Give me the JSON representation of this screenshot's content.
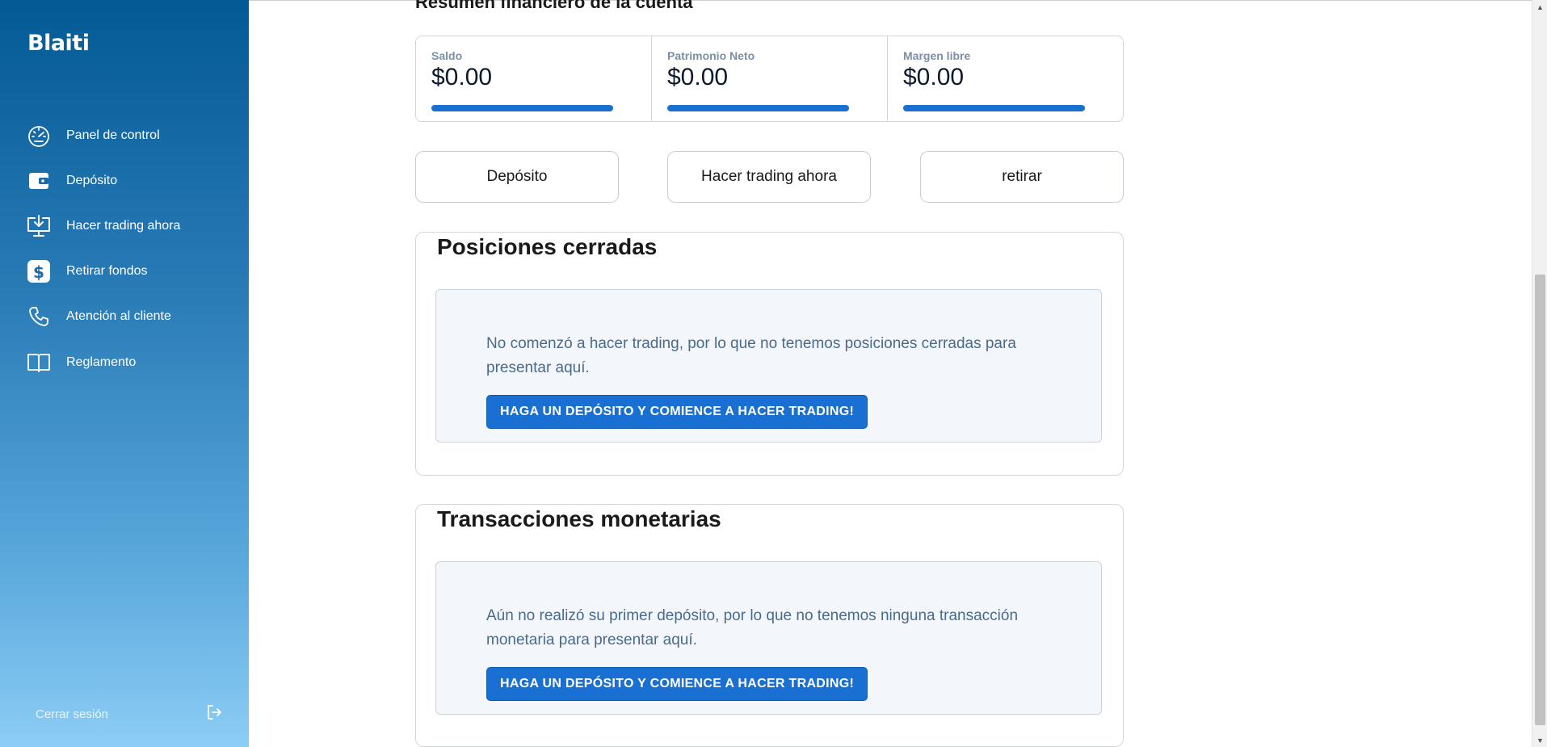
{
  "sidebar": {
    "brand": "Blaiti",
    "items": [
      {
        "label": "Panel de control",
        "icon": "gauge-icon"
      },
      {
        "label": "Depósito",
        "icon": "wallet-icon"
      },
      {
        "label": "Hacer trading ahora",
        "icon": "monitor-download-icon"
      },
      {
        "label": "Retirar fondos",
        "icon": "dollar-icon"
      },
      {
        "label": "Atención al cliente",
        "icon": "phone-icon"
      },
      {
        "label": "Reglamento",
        "icon": "book-icon"
      }
    ],
    "logout_label": "Cerrar sesión",
    "logout_icon": "logout-icon"
  },
  "main": {
    "section_heading": "Resumen financiero de la cuenta",
    "summary": [
      {
        "label": "Saldo",
        "value": "$0.00"
      },
      {
        "label": "Patrimonio Neto",
        "value": "$0.00"
      },
      {
        "label": "Margen libre",
        "value": "$0.00"
      }
    ],
    "actions": [
      "Depósito",
      "Hacer trading ahora",
      "retirar"
    ],
    "closed_positions": {
      "title": "Posiciones cerradas",
      "message": "No comenzó a hacer trading, por lo que no tenemos posiciones cerradas para presentar aquí.",
      "cta": "HAGA UN DEPÓSITO Y COMIENCE A HACER TRADING!"
    },
    "transactions": {
      "title": "Transacciones monetarias",
      "message": "Aún no realizó su primer depósito, por lo que no tenemos ninguna transacción monetaria para presentar aquí.",
      "cta": "HAGA UN DEPÓSITO Y COMIENCE A HACER TRADING!"
    }
  },
  "colors": {
    "accent": "#1970d2",
    "sidebar_top": "#035a95",
    "sidebar_bottom": "#8ccdf5",
    "empty_text": "#4a6a8b"
  }
}
